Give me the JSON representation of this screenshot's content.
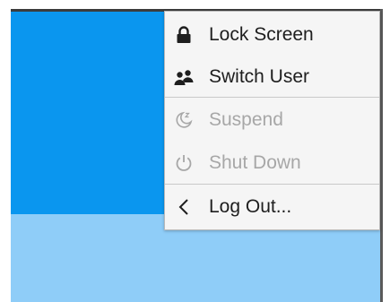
{
  "colors": {
    "desktop_top": "#0a96ef",
    "desktop_bottom": "#8fcdf8",
    "menu_background": "#f5f5f5",
    "enabled_text": "#1e1e1e",
    "disabled_text": "#a7a7a7"
  },
  "session_menu": {
    "items": [
      {
        "label": "Lock Screen",
        "icon": "lock-icon",
        "enabled": true
      },
      {
        "label": "Switch User",
        "icon": "users-icon",
        "enabled": true
      },
      {
        "label": "Suspend",
        "icon": "sleep-moon-icon",
        "enabled": false
      },
      {
        "label": "Shut Down",
        "icon": "power-icon",
        "enabled": false
      },
      {
        "label": "Log Out...",
        "icon": "chevron-left-icon",
        "enabled": true
      }
    ]
  }
}
